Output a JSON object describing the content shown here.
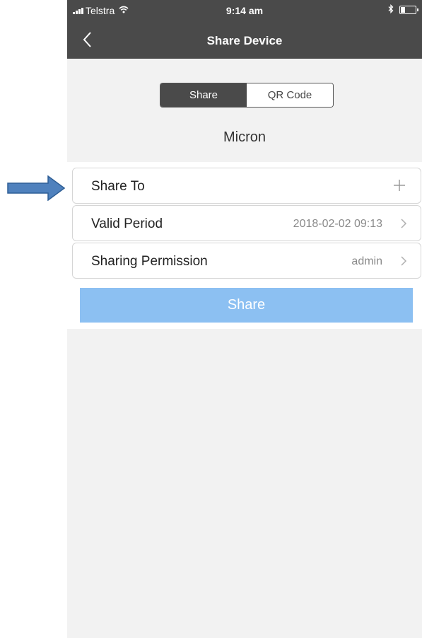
{
  "status_bar": {
    "carrier": "Telstra",
    "time": "9:14 am"
  },
  "nav": {
    "title": "Share Device",
    "back_icon": "chevron-left-icon"
  },
  "segmented_control": {
    "options": [
      "Share",
      "QR Code"
    ],
    "selected": "Share"
  },
  "device": {
    "name": "Micron"
  },
  "rows": [
    {
      "label": "Share To",
      "value": "",
      "icon": "plus-icon"
    },
    {
      "label": "Valid Period",
      "value": "2018-02-02 09:13",
      "icon": "chevron-right-icon"
    },
    {
      "label": "Sharing Permission",
      "value": "admin",
      "icon": "chevron-right-icon"
    }
  ],
  "share_button": {
    "label": "Share"
  },
  "colors": {
    "header_bg": "#4a4a4a",
    "share_button_bg": "#8cc0f2",
    "page_bg": "#f2f2f2",
    "annotation_arrow": "#4f81bd"
  }
}
